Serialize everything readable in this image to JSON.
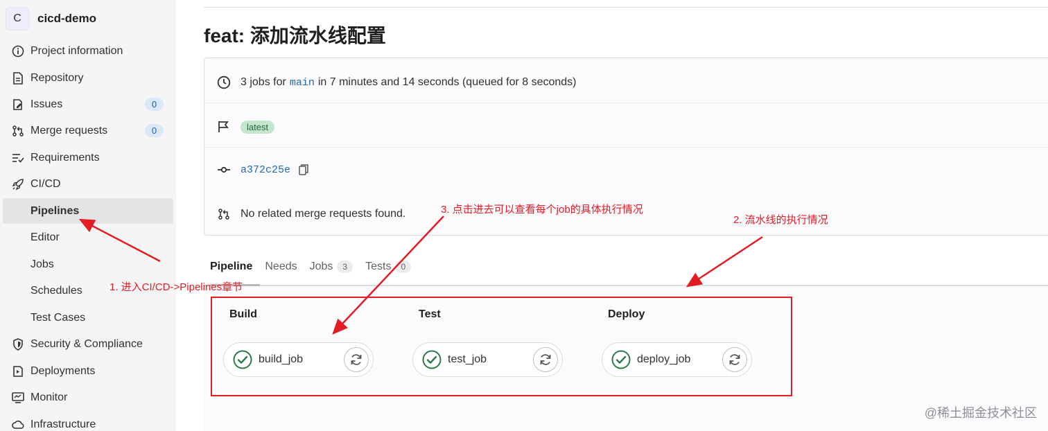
{
  "project": {
    "avatar_letter": "C",
    "name": "cicd-demo"
  },
  "sidebar": {
    "items": [
      {
        "label": "Project information",
        "icon": "info-icon"
      },
      {
        "label": "Repository",
        "icon": "document-icon"
      },
      {
        "label": "Issues",
        "icon": "issues-icon",
        "badge": "0"
      },
      {
        "label": "Merge requests",
        "icon": "merge-request-icon",
        "badge": "0"
      },
      {
        "label": "Requirements",
        "icon": "requirements-icon"
      },
      {
        "label": "CI/CD",
        "icon": "rocket-icon"
      },
      {
        "label": "Pipelines",
        "active": true
      },
      {
        "label": "Editor"
      },
      {
        "label": "Jobs"
      },
      {
        "label": "Schedules"
      },
      {
        "label": "Test Cases"
      },
      {
        "label": "Security & Compliance",
        "icon": "shield-icon"
      },
      {
        "label": "Deployments",
        "icon": "deployments-icon"
      },
      {
        "label": "Monitor",
        "icon": "monitor-icon"
      },
      {
        "label": "Infrastructure",
        "icon": "cloud-icon"
      }
    ]
  },
  "pipeline": {
    "title": "feat: 添加流水线配置",
    "summary_pre": "3 jobs for",
    "branch": "main",
    "summary_post": "in 7 minutes and 14 seconds (queued for 8 seconds)",
    "tag": "latest",
    "commit_sha": "a372c25e",
    "merge_requests_text": "No related merge requests found."
  },
  "tabs": [
    {
      "label": "Pipeline",
      "active": true
    },
    {
      "label": "Needs"
    },
    {
      "label": "Jobs",
      "count": "3"
    },
    {
      "label": "Tests",
      "count": "0"
    }
  ],
  "stages": [
    {
      "name": "Build",
      "job": "build_job",
      "status": "success"
    },
    {
      "name": "Test",
      "job": "test_job",
      "status": "success"
    },
    {
      "name": "Deploy",
      "job": "deploy_job",
      "status": "success"
    }
  ],
  "annotations": {
    "a1": "1. 进入CI/CD->Pipelines章节",
    "a2": "2. 流水线的执行情况",
    "a3": "3. 点击进去可以查看每个job的具体执行情况"
  },
  "colors": {
    "annotation": "#e31b23",
    "success": "#2a7a47",
    "link": "#1f68b3"
  },
  "watermark": "@稀土掘金技术社区"
}
